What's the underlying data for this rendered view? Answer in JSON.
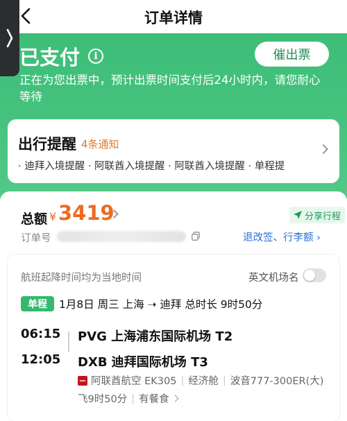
{
  "nav": {
    "title": "订单详情"
  },
  "status": {
    "title": "已支付",
    "urge_button": "催出票",
    "description": "正在为您出票中，预计出票时间支付后24小时内，请您耐心等待"
  },
  "reminder": {
    "title": "出行提醒",
    "count": "4条通知",
    "items": "· 迪拜入境提醒 · 阿联酋入境提醒 · 阿联酋入境提醒 · 单程提"
  },
  "order": {
    "total_label": "总额",
    "currency": "¥",
    "amount": "3419",
    "share_label": "分享行程",
    "order_no_label": "订单号",
    "refund_link": "退改签、行李额 ›"
  },
  "flight": {
    "timezone_note": "航班起降时间均为当地时间",
    "english_name_label": "英文机场名",
    "english_name_on": false,
    "trip_badge": "单程",
    "summary": "1月8日 周三 上海 ➝ 迪拜 总时长 9时50分",
    "depart_time": "06:15",
    "depart_airport": "PVG 上海浦东国际机场 T2",
    "arrive_time": "12:05",
    "arrive_airport": "DXB 迪拜国际机场 T3",
    "airline": "阿联酋航空 EK305",
    "cabin": "经济舱",
    "aircraft": "波音777-300ER(大)",
    "duration": "飞9时50分",
    "meal": "有餐食"
  },
  "colors": {
    "brand_green": "#3dbd78",
    "price_orange": "#ee6a22",
    "link_blue": "#2a6fd8"
  }
}
